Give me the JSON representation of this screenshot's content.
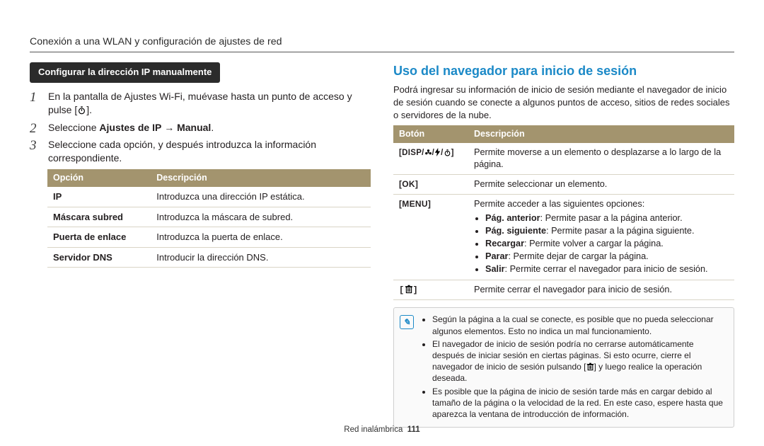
{
  "header": "Conexión a una WLAN y configuración de ajustes de red",
  "left": {
    "pill": "Configurar la dirección IP manualmente",
    "step1_a": "En la pantalla de Ajustes Wi-Fi, muévase hasta un punto de acceso y pulse [",
    "step1_b": "].",
    "step2_a": "Seleccione ",
    "step2_b": "Ajustes de IP",
    "step2_c": " → ",
    "step2_d": "Manual",
    "step2_e": ".",
    "step3": "Seleccione cada opción, y después introduzca la información correspondiente.",
    "tbl": {
      "h1": "Opción",
      "h2": "Descripción",
      "rows": [
        {
          "o": "IP",
          "d": "Introduzca una dirección IP estática."
        },
        {
          "o": "Máscara subred",
          "d": "Introduzca la máscara de subred."
        },
        {
          "o": "Puerta de enlace",
          "d": "Introduzca la puerta de enlace."
        },
        {
          "o": "Servidor DNS",
          "d": "Introducir la dirección DNS."
        }
      ]
    }
  },
  "right": {
    "heading": "Uso del navegador para inicio de sesión",
    "intro": "Podrá ingresar su información de inicio de sesión mediante el navegador de inicio de sesión cuando se conecte a algunos puntos de acceso, sitios de redes sociales o servidores de la nube.",
    "tbl": {
      "h1": "Botón",
      "h2": "Descripción",
      "r1": {
        "d": "Permite moverse a un elemento o desplazarse a lo largo de la página."
      },
      "r2": {
        "b": "[OK]",
        "d": "Permite seleccionar un elemento."
      },
      "r3": {
        "b": "[MENU]",
        "intro": "Permite acceder a las siguientes opciones:",
        "items": [
          {
            "k": "Pág. anterior",
            "v": ": Permite pasar a la página anterior."
          },
          {
            "k": "Pág. siguiente",
            "v": ": Permite pasar a la página siguiente."
          },
          {
            "k": "Recargar",
            "v": ": Permite volver a cargar la página."
          },
          {
            "k": "Parar",
            "v": ": Permite dejar de cargar la página."
          },
          {
            "k": "Salir",
            "v": ": Permite cerrar el navegador para inicio de sesión."
          }
        ]
      },
      "r4": {
        "d": "Permite cerrar el navegador para inicio de sesión."
      }
    },
    "note": {
      "n1": "Según la página a la cual se conecte, es posible que no pueda seleccionar algunos elementos. Esto no indica un mal funcionamiento.",
      "n2a": "El navegador de inicio de sesión podría no cerrarse automáticamente después de iniciar sesión en ciertas páginas. Si esto ocurre, cierre el navegador de inicio de sesión pulsando [",
      "n2b": "] y luego realice la operación deseada.",
      "n3": "Es posible que la página de inicio de sesión tarde más en cargar debido al tamaño de la página o la velocidad de la red. En este caso, espere hasta que aparezca la ventana de introducción de información."
    }
  },
  "footer": {
    "label": "Red inalámbrica",
    "page": "111"
  }
}
